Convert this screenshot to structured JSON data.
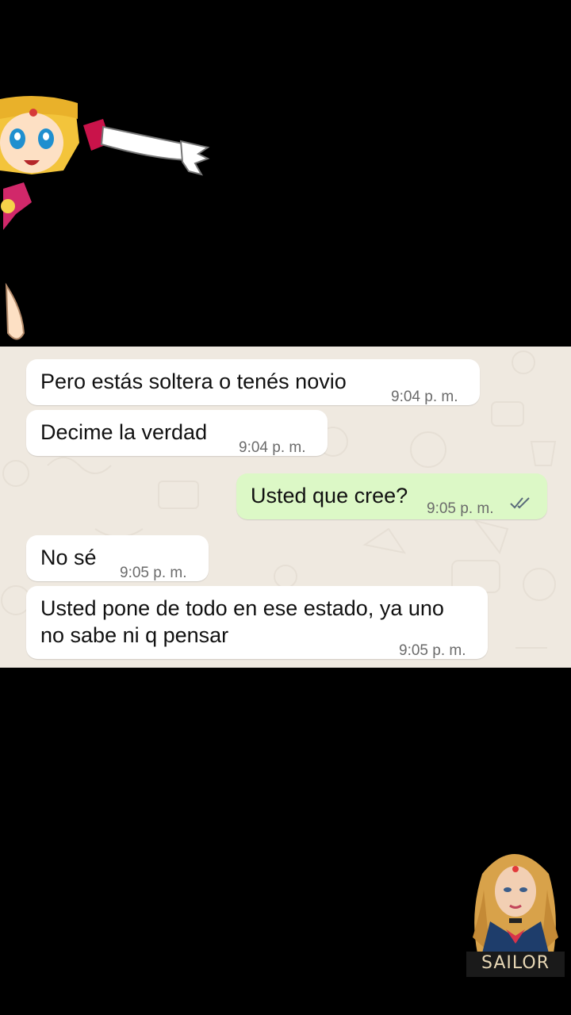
{
  "messages": [
    {
      "direction": "in",
      "text": "Pero estás soltera o tenés novio",
      "time": "9:04 p. m."
    },
    {
      "direction": "in",
      "text": "Decime la verdad",
      "time": "9:04 p. m."
    },
    {
      "direction": "out",
      "text": "Usted que cree?",
      "time": "9:05 p. m.",
      "status": "read-double-check"
    },
    {
      "direction": "in",
      "text": "No sé",
      "time": "9:05 p. m."
    },
    {
      "direction": "in",
      "text_line1": "Usted pone de todo en ese estado, ya uno",
      "text_line2": "no sabe ni q pensar",
      "time": "9:05 p. m."
    }
  ],
  "watermark": {
    "label": "SAILOR"
  },
  "colors": {
    "background": "#000000",
    "chat_wallpaper": "#efe9e0",
    "incoming_bubble": "#ffffff",
    "outgoing_bubble": "#dcf8c6",
    "read_ticks": "#5a6b7a"
  },
  "icons": {
    "top_left": "anime-sticker-icon",
    "bottom_right": "avatar-watermark-icon"
  }
}
